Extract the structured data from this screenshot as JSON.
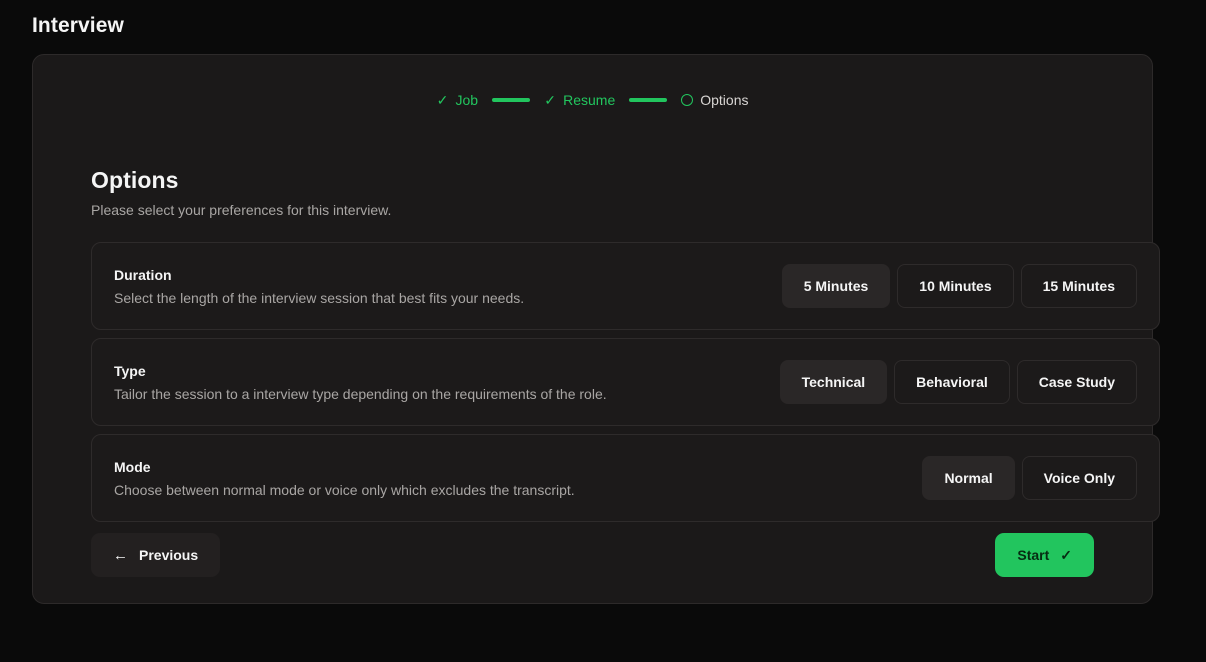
{
  "page": {
    "title": "Interview"
  },
  "stepper": {
    "steps": [
      {
        "label": "Job",
        "icon": "check-icon",
        "state": "done"
      },
      {
        "label": "Resume",
        "icon": "check-icon",
        "state": "done"
      },
      {
        "label": "Options",
        "icon": "circle-icon",
        "state": "current"
      }
    ],
    "check_glyph": "✓",
    "connector_color": "#22c55e"
  },
  "section": {
    "title": "Options",
    "subtitle": "Please select your preferences for this interview."
  },
  "options": [
    {
      "label": "Duration",
      "description": "Select the length of the interview session that best fits your needs.",
      "choices": [
        {
          "label": "5 Minutes",
          "selected": true
        },
        {
          "label": "10 Minutes",
          "selected": false
        },
        {
          "label": "15 Minutes",
          "selected": false
        }
      ]
    },
    {
      "label": "Type",
      "description": "Tailor the session to a interview type depending on the requirements of the role.",
      "choices": [
        {
          "label": "Technical",
          "selected": true
        },
        {
          "label": "Behavioral",
          "selected": false
        },
        {
          "label": "Case Study",
          "selected": false
        }
      ]
    },
    {
      "label": "Mode",
      "description": "Choose between normal mode or voice only which excludes the transcript.",
      "choices": [
        {
          "label": "Normal",
          "selected": true
        },
        {
          "label": "Voice Only",
          "selected": false
        }
      ]
    }
  ],
  "footer": {
    "previous": {
      "label": "Previous",
      "icon": "arrow-left-icon",
      "glyph": "←"
    },
    "start": {
      "label": "Start",
      "icon": "check-icon",
      "glyph": "✓",
      "color": "#22c55e"
    }
  }
}
